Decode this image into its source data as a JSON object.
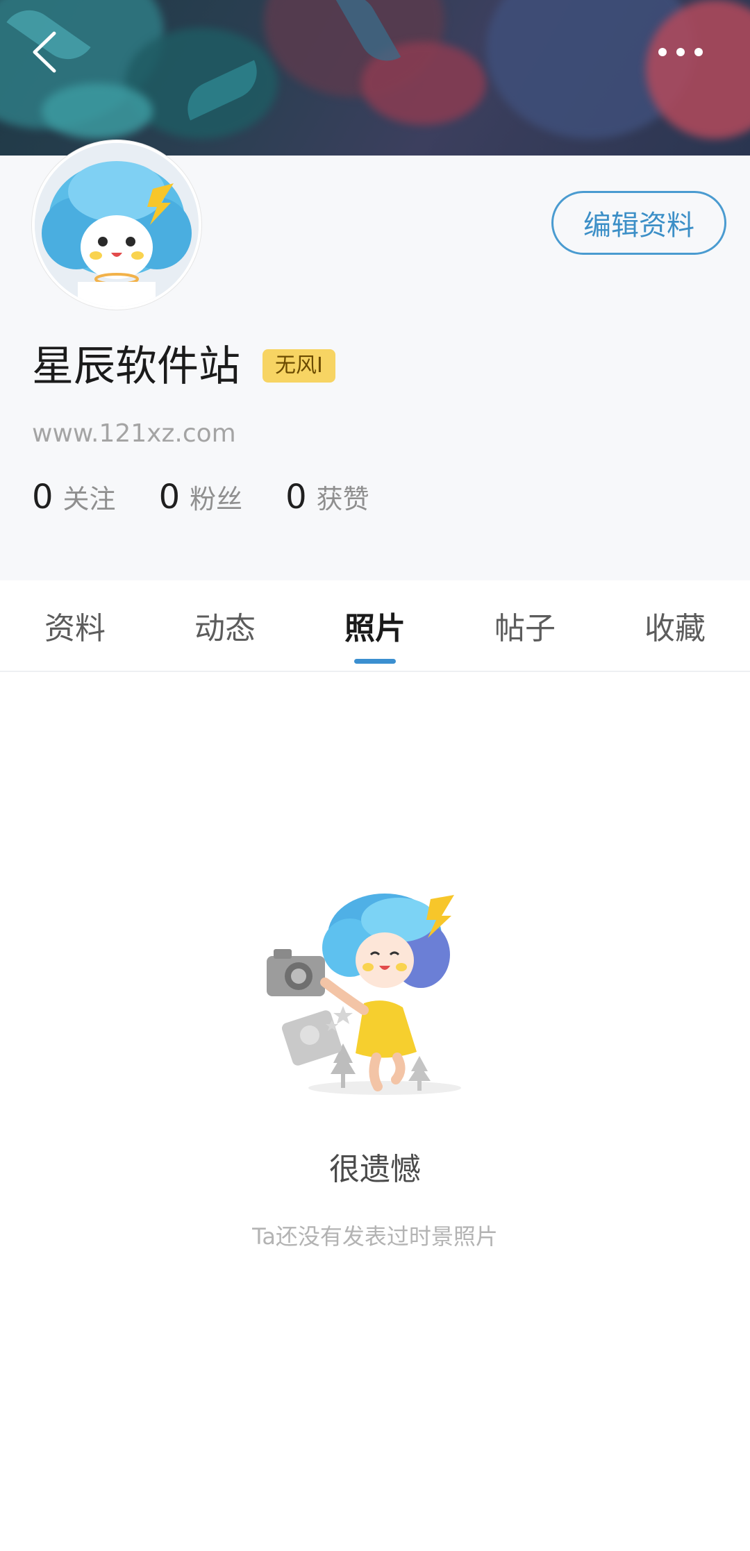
{
  "header": {
    "back_icon": "chevron-left-icon",
    "more_icon": "more-horizontal-icon"
  },
  "profile": {
    "name": "星辰软件站",
    "badge": "无风I",
    "website": "www.121xz.com",
    "edit_button": "编辑资料",
    "stats": [
      {
        "count": "0",
        "label": "关注"
      },
      {
        "count": "0",
        "label": "粉丝"
      },
      {
        "count": "0",
        "label": "获赞"
      }
    ]
  },
  "tabs": [
    {
      "label": "资料"
    },
    {
      "label": "动态"
    },
    {
      "label": "照片"
    },
    {
      "label": "帖子"
    },
    {
      "label": "收藏"
    }
  ],
  "active_tab": "照片",
  "empty_state": {
    "title": "很遗憾",
    "subtitle": "Ta还没有发表过时景照片"
  },
  "colors": {
    "accent": "#3b8fd0",
    "badge_bg": "#f7d463"
  }
}
